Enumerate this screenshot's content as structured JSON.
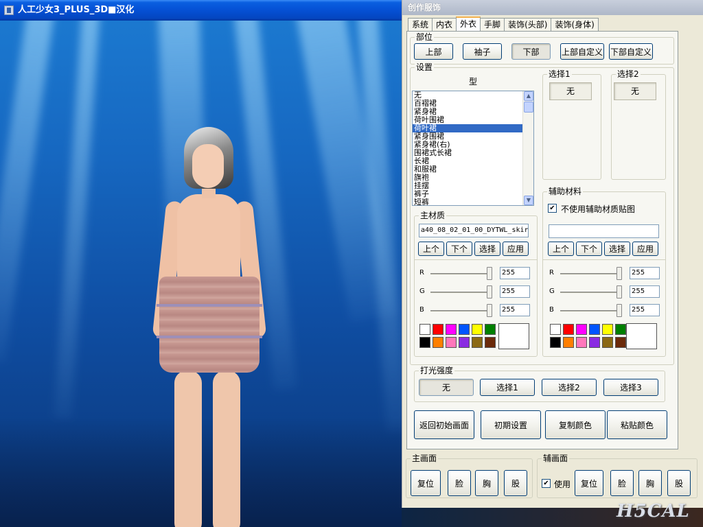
{
  "game_window": {
    "title": "人工少女3_PLUS_3D■汉化"
  },
  "dialog": {
    "title": "创作服饰",
    "tabs": [
      {
        "label": "系统",
        "active": false
      },
      {
        "label": "内衣",
        "active": false
      },
      {
        "label": "外衣",
        "active": true
      },
      {
        "label": "手脚",
        "active": false
      },
      {
        "label": "装饰(头部)",
        "active": false
      },
      {
        "label": "装饰(身体)",
        "active": false
      }
    ],
    "parts": {
      "label": "部位",
      "buttons": [
        {
          "label": "上部",
          "pressed": false
        },
        {
          "label": "袖子",
          "pressed": false
        },
        {
          "label": "下部",
          "pressed": true
        },
        {
          "label": "上部自定义",
          "pressed": false
        },
        {
          "label": "下部自定义",
          "pressed": false
        }
      ]
    },
    "settings": {
      "label": "设置",
      "type_header": "型",
      "type_list": [
        "无",
        "百褶裙",
        "紧身裙",
        "荷叶围裙",
        "荷叶裙",
        "紧身围裙",
        "紧身裙(右)",
        "围裙式长裙",
        "长裙",
        "和服裙",
        "旗袍",
        "挂摆",
        "裤子",
        "短裤"
      ],
      "selected_index": 4,
      "choice1": {
        "label": "选择1",
        "value": "无"
      },
      "choice2": {
        "label": "选择2",
        "value": "无"
      }
    },
    "main_material": {
      "label": "主材质",
      "filename": "a40_08_02_01_00_DYTWL_skir",
      "buttons": [
        "上个",
        "下个",
        "选择",
        "应用"
      ],
      "rgb": {
        "R": "255",
        "G": "255",
        "B": "255"
      }
    },
    "aux_material": {
      "label": "辅助材料",
      "checkbox_label": "不使用辅助材质贴图",
      "checked": true,
      "filename": "",
      "buttons": [
        "上个",
        "下个",
        "选择",
        "应用"
      ],
      "rgb": {
        "R": "255",
        "G": "255",
        "B": "255"
      }
    },
    "palette": [
      "#ffffff",
      "#ff0000",
      "#ff00ff",
      "#0055ff",
      "#ffff00",
      "#008000",
      "#000000",
      "#ff7f00",
      "#ff77bb",
      "#8a2be2",
      "#8b6914",
      "#6b2a0a"
    ],
    "lighting": {
      "label": "打光强度",
      "buttons": [
        {
          "label": "无",
          "pressed": true
        },
        {
          "label": "选择1",
          "pressed": false
        },
        {
          "label": "选择2",
          "pressed": false
        },
        {
          "label": "选择3",
          "pressed": false
        }
      ]
    },
    "actions": [
      "返回初始画面",
      "初期设置",
      "复制颜色",
      "粘贴颜色"
    ],
    "main_screen": {
      "label": "主画面",
      "buttons": [
        "复位",
        "脸",
        "胸",
        "股"
      ]
    },
    "aux_screen": {
      "label": "辅画面",
      "use_label": "使用",
      "use_checked": true,
      "buttons": [
        "复位",
        "脸",
        "胸",
        "股"
      ]
    }
  },
  "watermark": "H5CAL",
  "colors": {
    "titlebar": "#0550d4",
    "dialog_bg": "#ece9d8",
    "selection": "#316ac5",
    "active_tab_accent": "#f2b04d"
  }
}
